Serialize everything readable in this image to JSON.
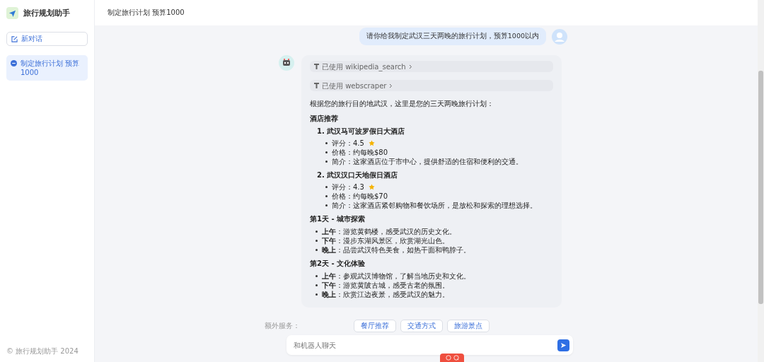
{
  "sidebar": {
    "app_title": "旅行规划助手",
    "new_chat_button": "新对话",
    "conversations": [
      {
        "title": "制定旅行计划 预算1000",
        "selected": true
      }
    ],
    "footer": "© 旅行规划助手 2024"
  },
  "header": {
    "title": "制定旅行计划 预算1000"
  },
  "messages": [
    {
      "kind": "user",
      "text": "请你给我制定武汉三天两晚的旅行计划，预算1000以内"
    },
    {
      "kind": "assistant",
      "tool_calls": [
        {
          "label": "已使用 wikipedia_search"
        },
        {
          "label": "已使用 webscraper"
        }
      ],
      "blocks": [
        {
          "kind": "paragraph",
          "text": "根据您的旅行目的地武汉，这里是您的三天两晚旅行计划："
        },
        {
          "kind": "heading",
          "text": "酒店推荐"
        },
        {
          "kind": "numbered",
          "number": "1.",
          "title": "武汉马可波罗假日大酒店",
          "bullets": [
            {
              "text": "评分：4.5",
              "star": true
            },
            {
              "text": "价格：约每晚$80",
              "star": false
            },
            {
              "text": "简介：这家酒店位于市中心，提供舒适的住宿和便利的交通。",
              "star": false
            }
          ]
        },
        {
          "kind": "numbered",
          "number": "2.",
          "title": "武汉汉口天地假日酒店",
          "bullets": [
            {
              "text": "评分：4.3",
              "star": true
            },
            {
              "text": "价格：约每晚$70",
              "star": false
            },
            {
              "text": "简介：这家酒店紧邻购物和餐饮场所，是放松和探索的理想选择。",
              "star": false
            }
          ]
        },
        {
          "kind": "heading",
          "text": "第1天 - 城市探索"
        },
        {
          "kind": "list",
          "items": [
            "**上午**：游览黄鹤楼，感受武汉的历史文化。",
            "**下午**：漫步东湖风景区，欣赏湖光山色。",
            "**晚上**：品尝武汉特色美食，如热干面和鸭脖子。"
          ]
        },
        {
          "kind": "heading",
          "text": "第2天 - 文化体验"
        },
        {
          "kind": "list",
          "items": [
            "**上午**：参观武汉博物馆，了解当地历史和文化。",
            "**下午**：游览黄陂古城，感受古老的氛围。",
            "**晚上**：欣赏江边夜景，感受武汉的魅力。"
          ]
        }
      ]
    }
  ],
  "extra_services": {
    "label": "额外服务：",
    "buttons": [
      "餐厅推荐",
      "交通方式",
      "旅游景点"
    ]
  },
  "input": {
    "placeholder": "和机器人聊天"
  }
}
